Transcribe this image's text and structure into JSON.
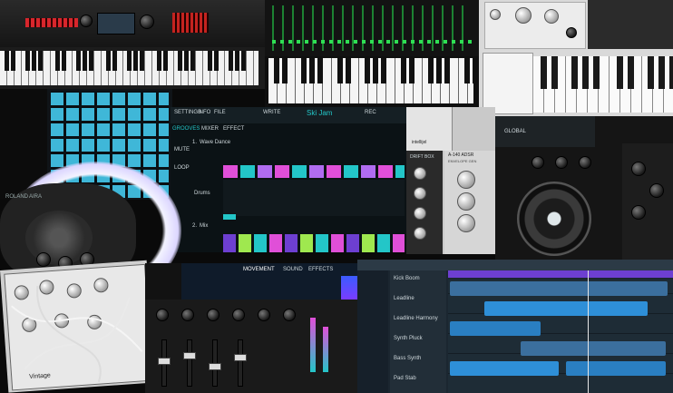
{
  "colors": {
    "accent_cyan": "#23c6c8",
    "pad_cyan": "#4fd2e6",
    "accent_magenta": "#e04fd8",
    "accent_lime": "#9fe84f",
    "track_purple": "#6d3fd1",
    "track_blue": "#2e8fd8",
    "dark_bg": "#0a0a0a"
  },
  "synth_top_left": {
    "brand": "",
    "icon": "keyboard-icon"
  },
  "app_ui": {
    "tabs": [
      "SETTINGS",
      "INFO",
      "FILE"
    ],
    "write_label": "WRITE",
    "song_name": "Ski Jam",
    "rec_label": "REC",
    "nav_tabs": [
      "GROOVES",
      "MIXER",
      "EFFECT"
    ],
    "rows": [
      {
        "num": "1.",
        "name": "Wave Dance"
      },
      {
        "num": "2.",
        "name": "Mix"
      }
    ],
    "side_labels": [
      "MUTE",
      "LOOP",
      "Drums"
    ]
  },
  "module_panel": {
    "title": "DRIFT BOX",
    "brand": "intellijel",
    "env_title": "A-140 ADSR",
    "env_sub": "ENVELOPE GEN"
  },
  "dj_controller": {
    "label": "GLOBAL",
    "icon": "jog-wheel-icon"
  },
  "daw": {
    "view_tabs": [
      "MOVEMENT",
      "SOUND",
      "EFFECTS"
    ],
    "track_names": [
      "Kick Boom",
      "Leadline",
      "Leadline Harmony",
      "Synth Pluck",
      "Bass Synth",
      "Pad Stab"
    ]
  },
  "roland_circle": {
    "brand": "ROLAND",
    "model": "AIRA"
  },
  "modular": {
    "brand": "Vintage"
  }
}
